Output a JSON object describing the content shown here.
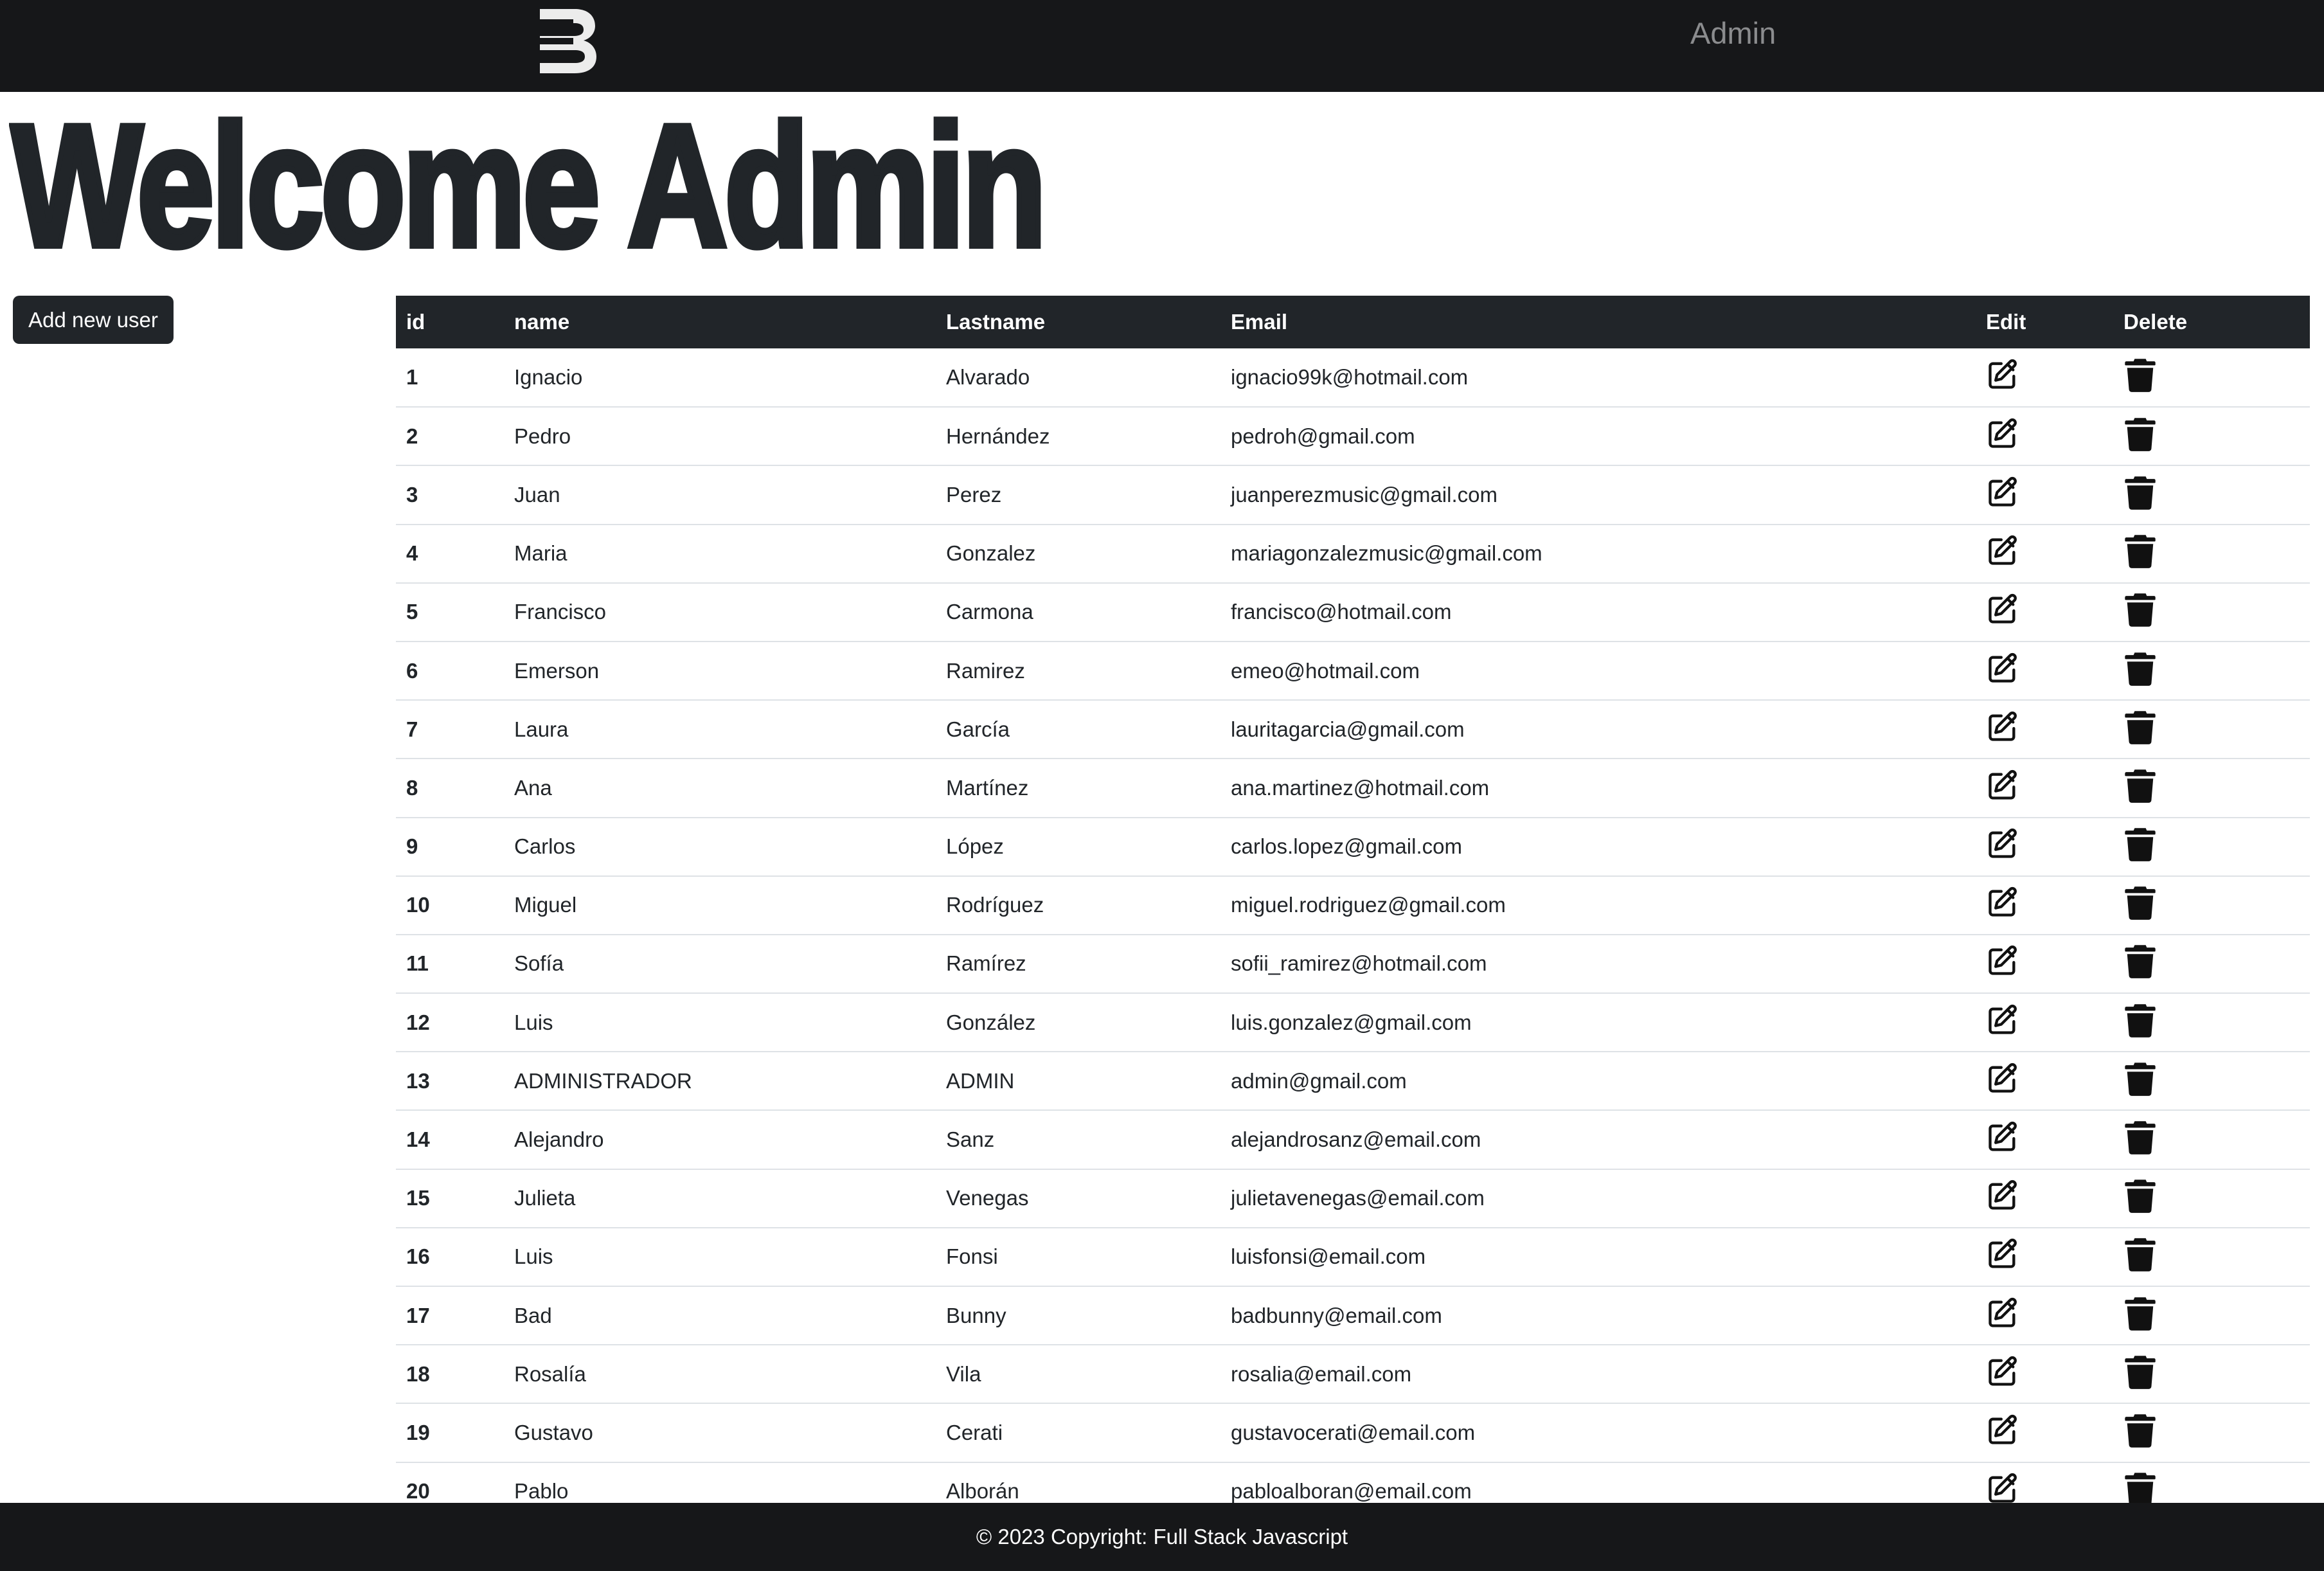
{
  "navbar": {
    "logo_icon": "brand-b-logo-icon",
    "admin_link": "Admin"
  },
  "main": {
    "title": "Welcome Admin",
    "add_user_label": "Add new user"
  },
  "table": {
    "columns": [
      "id",
      "name",
      "Lastname",
      "Email",
      "Edit",
      "Delete"
    ],
    "edit_icon": "edit-icon",
    "delete_icon": "trash-icon",
    "rows": [
      {
        "id": "1",
        "name": "Ignacio",
        "lastname": "Alvarado",
        "email": "ignacio99k@hotmail.com"
      },
      {
        "id": "2",
        "name": "Pedro",
        "lastname": "Hernández",
        "email": "pedroh@gmail.com"
      },
      {
        "id": "3",
        "name": "Juan",
        "lastname": "Perez",
        "email": "juanperezmusic@gmail.com"
      },
      {
        "id": "4",
        "name": "Maria",
        "lastname": "Gonzalez",
        "email": "mariagonzalezmusic@gmail.com"
      },
      {
        "id": "5",
        "name": "Francisco",
        "lastname": "Carmona",
        "email": "francisco@hotmail.com"
      },
      {
        "id": "6",
        "name": "Emerson",
        "lastname": "Ramirez",
        "email": "emeo@hotmail.com"
      },
      {
        "id": "7",
        "name": "Laura",
        "lastname": "García",
        "email": "lauritagarcia@gmail.com"
      },
      {
        "id": "8",
        "name": "Ana",
        "lastname": "Martínez",
        "email": "ana.martinez@hotmail.com"
      },
      {
        "id": "9",
        "name": "Carlos",
        "lastname": "López",
        "email": "carlos.lopez@gmail.com"
      },
      {
        "id": "10",
        "name": "Miguel",
        "lastname": "Rodríguez",
        "email": "miguel.rodriguez@gmail.com"
      },
      {
        "id": "11",
        "name": "Sofía",
        "lastname": "Ramírez",
        "email": "sofii_ramirez@hotmail.com"
      },
      {
        "id": "12",
        "name": "Luis",
        "lastname": "González",
        "email": "luis.gonzalez@gmail.com"
      },
      {
        "id": "13",
        "name": "ADMINISTRADOR",
        "lastname": "ADMIN",
        "email": "admin@gmail.com"
      },
      {
        "id": "14",
        "name": "Alejandro",
        "lastname": "Sanz",
        "email": "alejandrosanz@email.com"
      },
      {
        "id": "15",
        "name": "Julieta",
        "lastname": "Venegas",
        "email": "julietavenegas@email.com"
      },
      {
        "id": "16",
        "name": "Luis",
        "lastname": "Fonsi",
        "email": "luisfonsi@email.com"
      },
      {
        "id": "17",
        "name": "Bad",
        "lastname": "Bunny",
        "email": "badbunny@email.com"
      },
      {
        "id": "18",
        "name": "Rosalía",
        "lastname": "Vila",
        "email": "rosalia@email.com"
      },
      {
        "id": "19",
        "name": "Gustavo",
        "lastname": "Cerati",
        "email": "gustavocerati@email.com"
      },
      {
        "id": "20",
        "name": "Pablo",
        "lastname": "Alborán",
        "email": "pabloalboran@email.com"
      }
    ]
  },
  "footer": {
    "copyright": "© 2023 Copyright: Full Stack Javascript"
  },
  "colors": {
    "navbar_bg": "#161719",
    "table_header_bg": "#212529",
    "text": "#212529",
    "nav_link": "#8b8c8e"
  }
}
